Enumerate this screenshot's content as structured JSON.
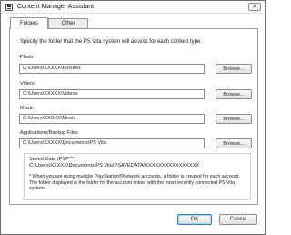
{
  "window": {
    "title": "Content Manager Assistant",
    "close_glyph": "✕"
  },
  "tabs": [
    {
      "label": "Folders",
      "selected": true
    },
    {
      "label": "Other",
      "selected": false
    }
  ],
  "folders": {
    "description": "Specify the folder that the PS Vita system will access for each content type.",
    "photo": {
      "label": "Photo",
      "value": "C:\\Users\\XXXXX\\Pictures",
      "browse": "Browse..."
    },
    "videos": {
      "label": "Videos",
      "value": "C:\\Users\\XXXXX\\Videos",
      "browse": "Browse..."
    },
    "music": {
      "label": "Music",
      "value": "C:\\Users\\XXXXX\\Music",
      "browse": "Browse..."
    },
    "applications": {
      "label": "Applications/Backup Files",
      "value": "C:\\Users\\XXXXX\\Documents\\PS Vita",
      "browse": "Browse..."
    },
    "saved_data": {
      "label": "Saved Data (PSP™)",
      "path": "C:\\Users\\XXXXX\\Documents\\PS Vita\\PSAVEDATA\\XXXXXXXXXXXXXXXX",
      "note": "* When you are using multiple PlayStation®Network accounts, a folder is created for each account. The folder displayed is the folder for the account linked with the most recently connected PS Vita system."
    }
  },
  "buttons": {
    "ok": "OK",
    "cancel": "Cancel"
  }
}
